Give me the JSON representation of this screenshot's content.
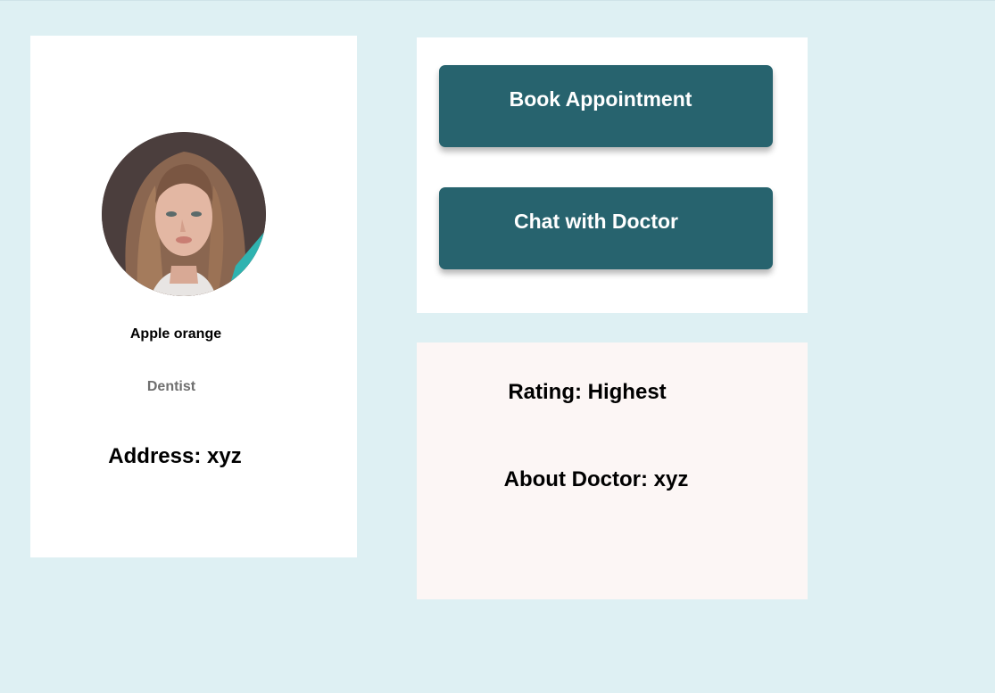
{
  "profile": {
    "name": "Apple orange",
    "specialty": "Dentist",
    "address": "Address: xyz",
    "avatar_icon": "profile-photo"
  },
  "actions": {
    "book_label": "Book Appointment",
    "chat_label": "Chat with Doctor"
  },
  "info": {
    "rating": "Rating: Highest",
    "about": "About Doctor: xyz"
  },
  "colors": {
    "background": "#def0f3",
    "button": "#27636e",
    "info_card": "#fcf6f5"
  }
}
